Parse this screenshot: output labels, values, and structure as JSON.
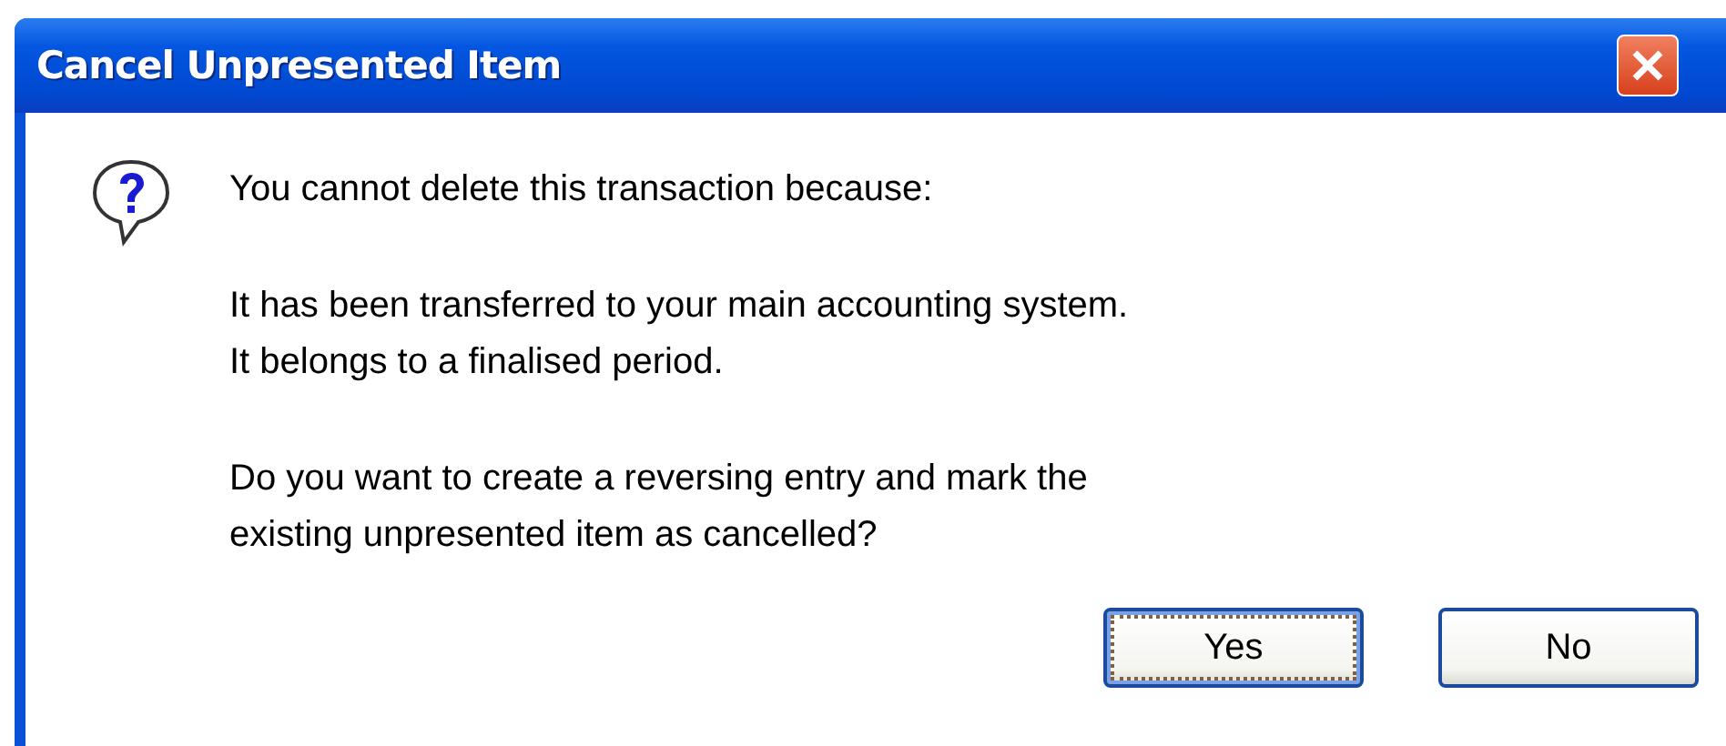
{
  "window": {
    "title": "Cancel Unpresented Item"
  },
  "message": {
    "paragraphs": [
      [
        "You cannot delete this transaction because:"
      ],
      [
        "It has been transferred to your main accounting system.",
        "It belongs to a finalised period."
      ],
      [
        "Do you want to create a reversing entry and mark the",
        "existing unpresented item as cancelled?"
      ]
    ]
  },
  "buttons": [
    {
      "label": "Yes",
      "focused": true
    },
    {
      "label": "No",
      "focused": false
    }
  ]
}
